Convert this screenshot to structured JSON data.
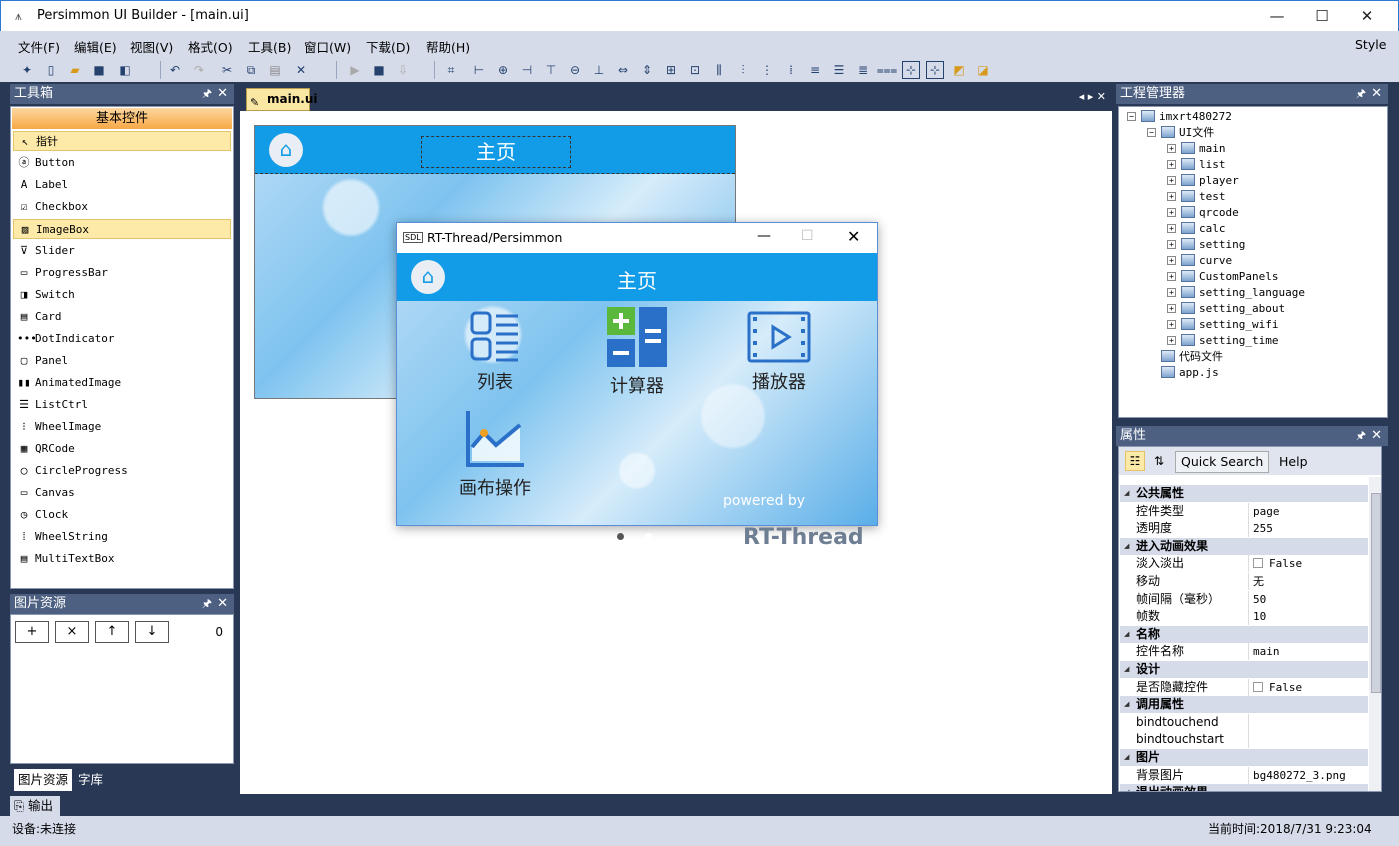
{
  "window": {
    "title": "Persimmon UI Builder - [main.ui]",
    "style_label": "Style"
  },
  "menu": [
    "文件(F)",
    "编辑(E)",
    "视图(V)",
    "格式(O)",
    "工具(B)",
    "窗口(W)",
    "下载(D)",
    "帮助(H)"
  ],
  "toolbox": {
    "title": "工具箱",
    "group": "基本控件",
    "items": [
      {
        "label": "指针",
        "icon": "pointer-icon"
      },
      {
        "label": "Button",
        "icon": "button-icon"
      },
      {
        "label": "Label",
        "icon": "label-icon"
      },
      {
        "label": "Checkbox",
        "icon": "checkbox-icon"
      },
      {
        "label": "ImageBox",
        "icon": "image-icon"
      },
      {
        "label": "Slider",
        "icon": "slider-icon"
      },
      {
        "label": "ProgressBar",
        "icon": "progressbar-icon"
      },
      {
        "label": "Switch",
        "icon": "switch-icon"
      },
      {
        "label": "Card",
        "icon": "card-icon"
      },
      {
        "label": "DotIndicator",
        "icon": "dots-icon"
      },
      {
        "label": "Panel",
        "icon": "panel-icon"
      },
      {
        "label": "AnimatedImage",
        "icon": "animated-icon"
      },
      {
        "label": "ListCtrl",
        "icon": "list-icon"
      },
      {
        "label": "WheelImage",
        "icon": "wheel-icon"
      },
      {
        "label": "QRCode",
        "icon": "qrcode-icon"
      },
      {
        "label": "CircleProgress",
        "icon": "circle-icon"
      },
      {
        "label": "Canvas",
        "icon": "canvas-icon"
      },
      {
        "label": "Clock",
        "icon": "clock-icon"
      },
      {
        "label": "WheelString",
        "icon": "wheelstring-icon"
      },
      {
        "label": "MultiTextBox",
        "icon": "multitext-icon"
      }
    ]
  },
  "image_resources": {
    "title": "图片资源",
    "buttons": [
      "+",
      "×",
      "↑",
      "↓"
    ],
    "count": "0"
  },
  "bottom_tabs": [
    "图片资源",
    "字库"
  ],
  "editor": {
    "tab": "main.ui",
    "page_title": "主页"
  },
  "preview": {
    "title": "RT-Thread/Persimmon",
    "logo": "SDL",
    "header": "主页",
    "apps": [
      "列表",
      "计算器",
      "播放器",
      "画布操作"
    ],
    "powered_by": "powered by",
    "brand": "RT-Thread"
  },
  "project": {
    "title": "工程管理器",
    "root": "imxrt480272",
    "ui_folder": "UI文件",
    "ui_files": [
      "main",
      "list",
      "player",
      "test",
      "qrcode",
      "calc",
      "setting",
      "curve",
      "CustomPanels",
      "setting_language",
      "setting_about",
      "setting_wifi",
      "setting_time"
    ],
    "code_folder": "代码文件",
    "app_js": "app.js"
  },
  "properties": {
    "title": "属性",
    "search": "Quick Search",
    "help": "Help",
    "rows": [
      {
        "type": "cat",
        "k": "公共属性"
      },
      {
        "type": "row",
        "k": "控件类型",
        "v": "page"
      },
      {
        "type": "row",
        "k": "透明度",
        "v": "255"
      },
      {
        "type": "cat",
        "k": "进入动画效果"
      },
      {
        "type": "row",
        "k": "淡入淡出",
        "v": "False",
        "cb": true
      },
      {
        "type": "row",
        "k": "移动",
        "v": "无"
      },
      {
        "type": "row",
        "k": "帧间隔（毫秒）",
        "v": "50"
      },
      {
        "type": "row",
        "k": "帧数",
        "v": "10"
      },
      {
        "type": "cat",
        "k": "名称"
      },
      {
        "type": "row",
        "k": "控件名称",
        "v": "main"
      },
      {
        "type": "cat",
        "k": "设计"
      },
      {
        "type": "row",
        "k": "是否隐藏控件",
        "v": "False",
        "cb": true
      },
      {
        "type": "cat",
        "k": "调用属性"
      },
      {
        "type": "row",
        "k": "bindtouchend",
        "v": ""
      },
      {
        "type": "row",
        "k": "bindtouchstart",
        "v": ""
      },
      {
        "type": "cat",
        "k": "图片"
      },
      {
        "type": "row",
        "k": "背景图片",
        "v": "bg480272_3.png"
      },
      {
        "type": "cat",
        "k": "退出动画效果"
      }
    ]
  },
  "output_tab": "输出",
  "status": {
    "device": "设备:未连接",
    "time": "当前时间:2018/7/31 9:23:04"
  }
}
